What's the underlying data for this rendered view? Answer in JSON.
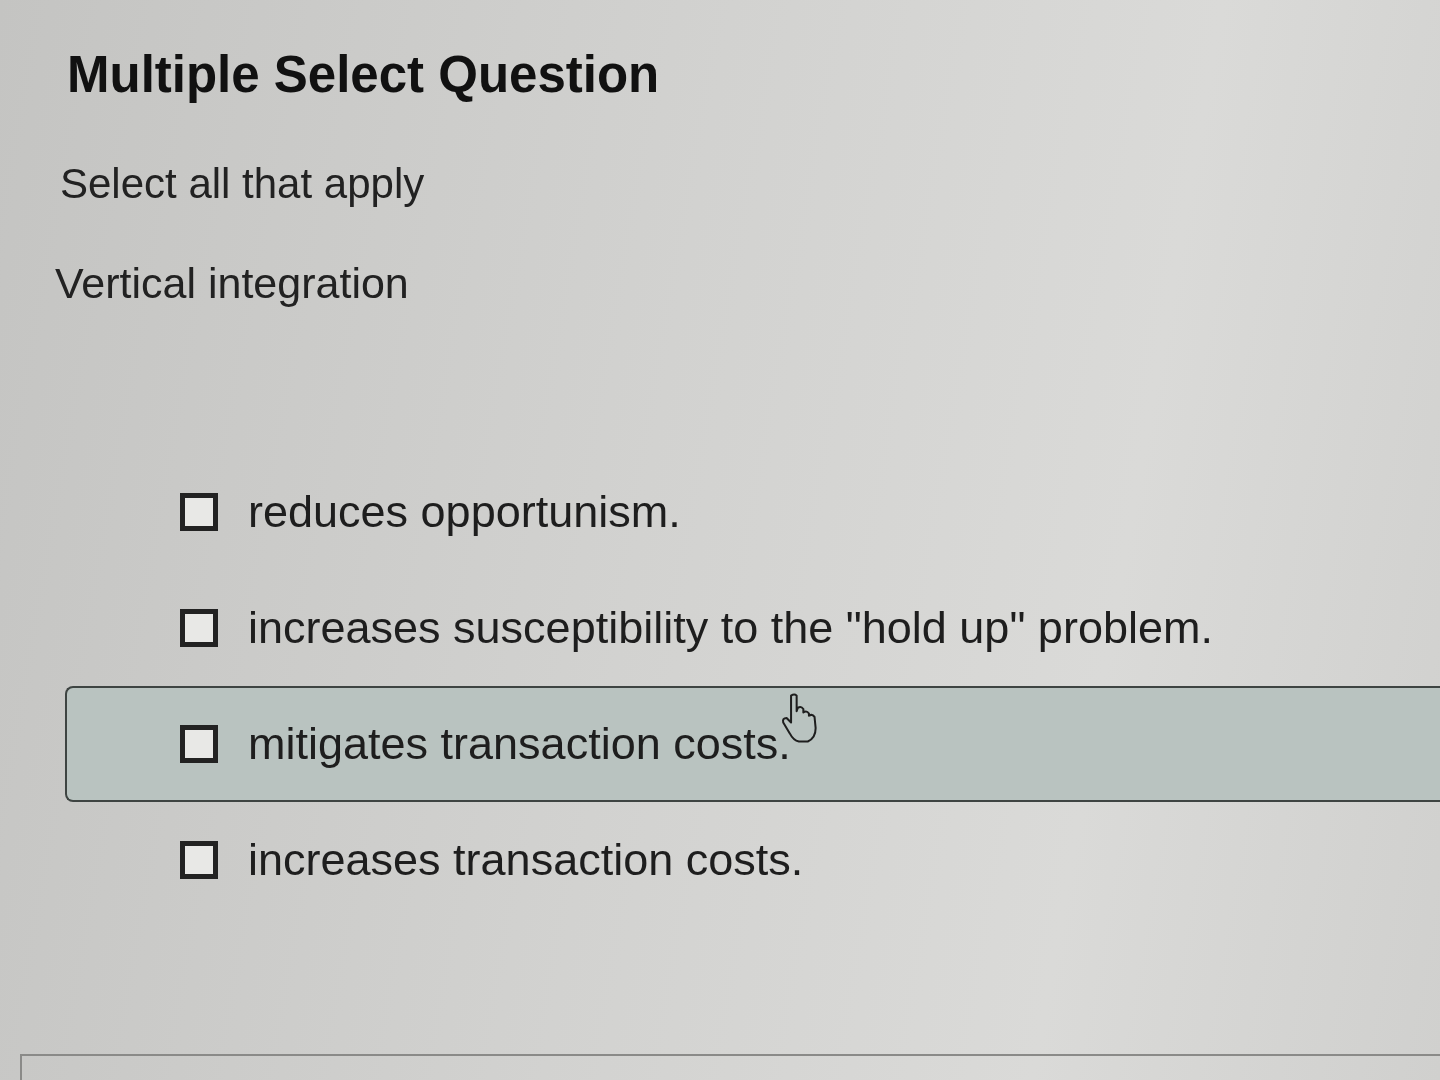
{
  "question": {
    "type_label": "Multiple Select Question",
    "instruction": "Select all that apply",
    "prompt": "Vertical integration"
  },
  "options": [
    {
      "label": "reduces opportunism.",
      "checked": false,
      "hovered": false
    },
    {
      "label": "increases susceptibility to the \"hold up\" problem.",
      "checked": false,
      "hovered": false
    },
    {
      "label": "mitigates transaction costs.",
      "checked": false,
      "hovered": true
    },
    {
      "label": "increases transaction costs.",
      "checked": false,
      "hovered": false
    }
  ]
}
